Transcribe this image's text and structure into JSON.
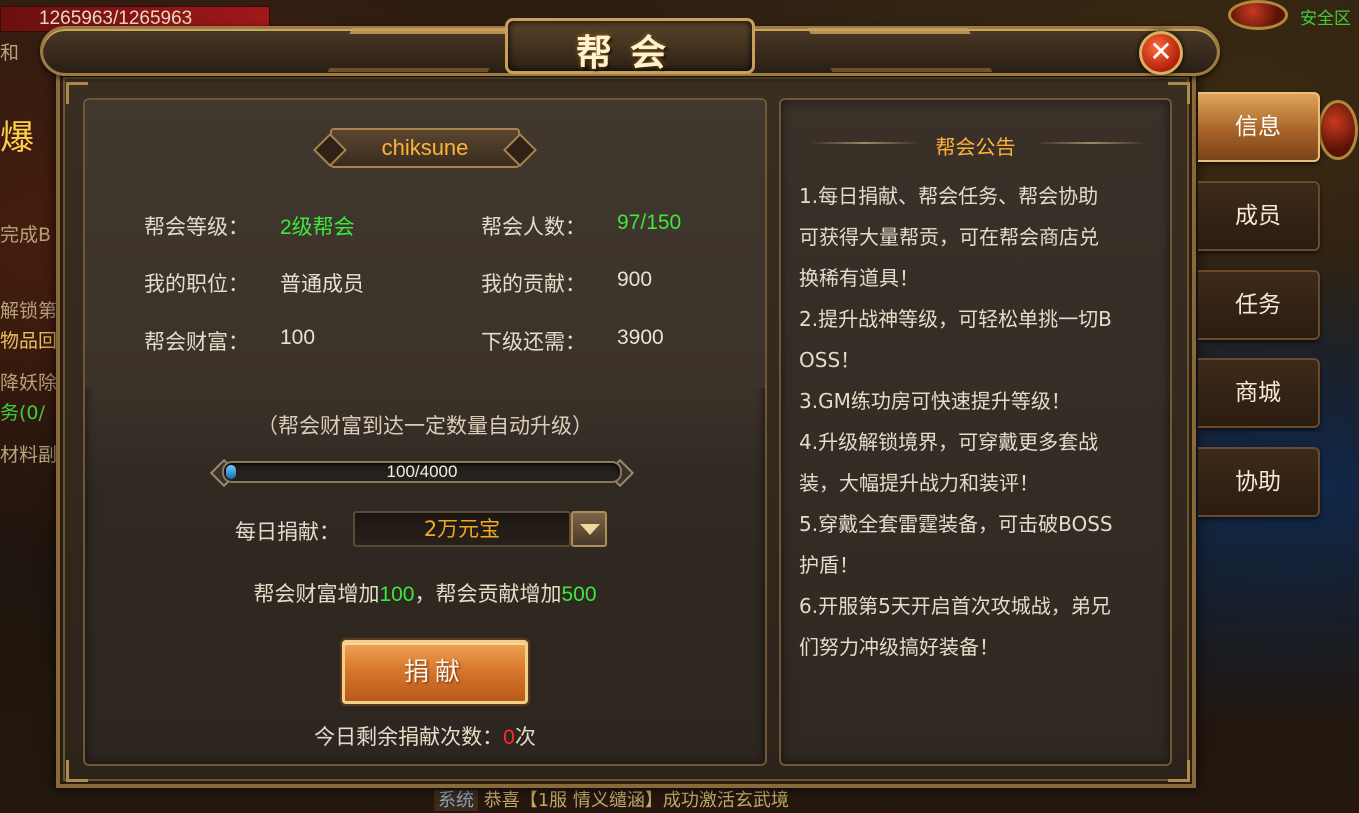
{
  "background": {
    "hp_text": "1265963/1265963",
    "safe_zone": "安全区",
    "left_texts": [
      "和",
      "爆",
      "完成B",
      "解锁第",
      "物品回",
      "降妖除",
      "务(0/",
      "材料副"
    ],
    "chat_system": "系统",
    "chat_message": "恭喜【1服 情义缱涵】成功激活玄武境"
  },
  "dialog": {
    "title": "帮会",
    "close_symbol": "✕"
  },
  "guild": {
    "name": "chiksune",
    "stats": [
      {
        "label": "帮会等级：",
        "value": "2级帮会"
      },
      {
        "label": "帮会人数：",
        "value": "97/150"
      },
      {
        "label": "我的职位：",
        "value": "普通成员"
      },
      {
        "label": "我的贡献：",
        "value": "900"
      },
      {
        "label": "帮会财富：",
        "value": "100"
      },
      {
        "label": "下级还需：",
        "value": "3900"
      }
    ],
    "upgrade_hint": "（帮会财富到达一定数量自动升级）",
    "progress": {
      "current": 100,
      "max": 4000,
      "text": "100/4000"
    },
    "donate_label": "每日捐献：",
    "donate_selected": "2万元宝",
    "bonus_prefix": "帮会财富增加",
    "bonus_wealth": "100",
    "bonus_mid": "，帮会贡献增加",
    "bonus_contrib": "500",
    "donate_button": "捐献",
    "remain_prefix": "今日剩余捐献次数：",
    "remain_count": "0",
    "remain_suffix": "次"
  },
  "notice": {
    "title": "帮会公告",
    "lines": [
      "1.每日捐献、帮会任务、帮会协助",
      "可获得大量帮贡，可在帮会商店兑",
      "换稀有道具！",
      "2.提升战神等级，可轻松单挑一切B",
      "OSS！",
      "3.GM练功房可快速提升等级！",
      "4.升级解锁境界，可穿戴更多套战",
      "装，大幅提升战力和装评！",
      "5.穿戴全套雷霆装备，可击破BOSS",
      "护盾！",
      "6.开服第5天开启首次攻城战，弟兄",
      "们努力冲级搞好装备！"
    ]
  },
  "tabs": [
    {
      "label": "信息",
      "active": true
    },
    {
      "label": "成员",
      "active": false
    },
    {
      "label": "任务",
      "active": false
    },
    {
      "label": "商城",
      "active": false
    },
    {
      "label": "协助",
      "active": false
    }
  ],
  "colors": {
    "accent_gold": "#ffb23a",
    "green_value": "#3ce83c",
    "red_count": "#ff2a2a",
    "button_orange": "#d9782c"
  }
}
